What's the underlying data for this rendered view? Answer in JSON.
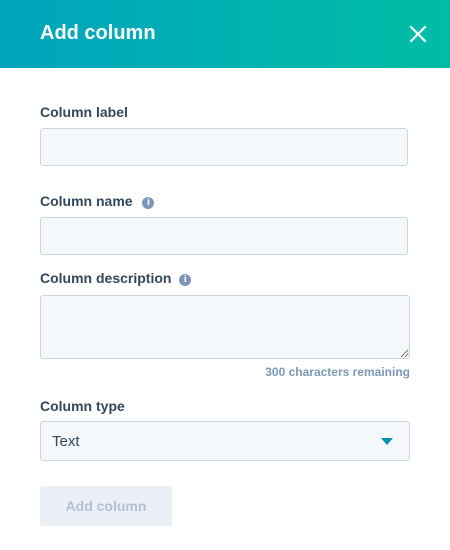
{
  "header": {
    "title": "Add column",
    "background_start": "#00a4bd",
    "background_end": "#00bda5"
  },
  "fields": {
    "column_label": {
      "label": "Column label",
      "value": ""
    },
    "column_name": {
      "label": "Column name",
      "value": ""
    },
    "column_description": {
      "label": "Column description",
      "value": "",
      "remaining": "300 characters remaining"
    },
    "column_type": {
      "label": "Column type",
      "selected": "Text"
    }
  },
  "actions": {
    "submit_label": "Add column"
  },
  "icons": {
    "close": "close-icon",
    "info": "info-icon",
    "caret": "chevron-down-icon"
  }
}
